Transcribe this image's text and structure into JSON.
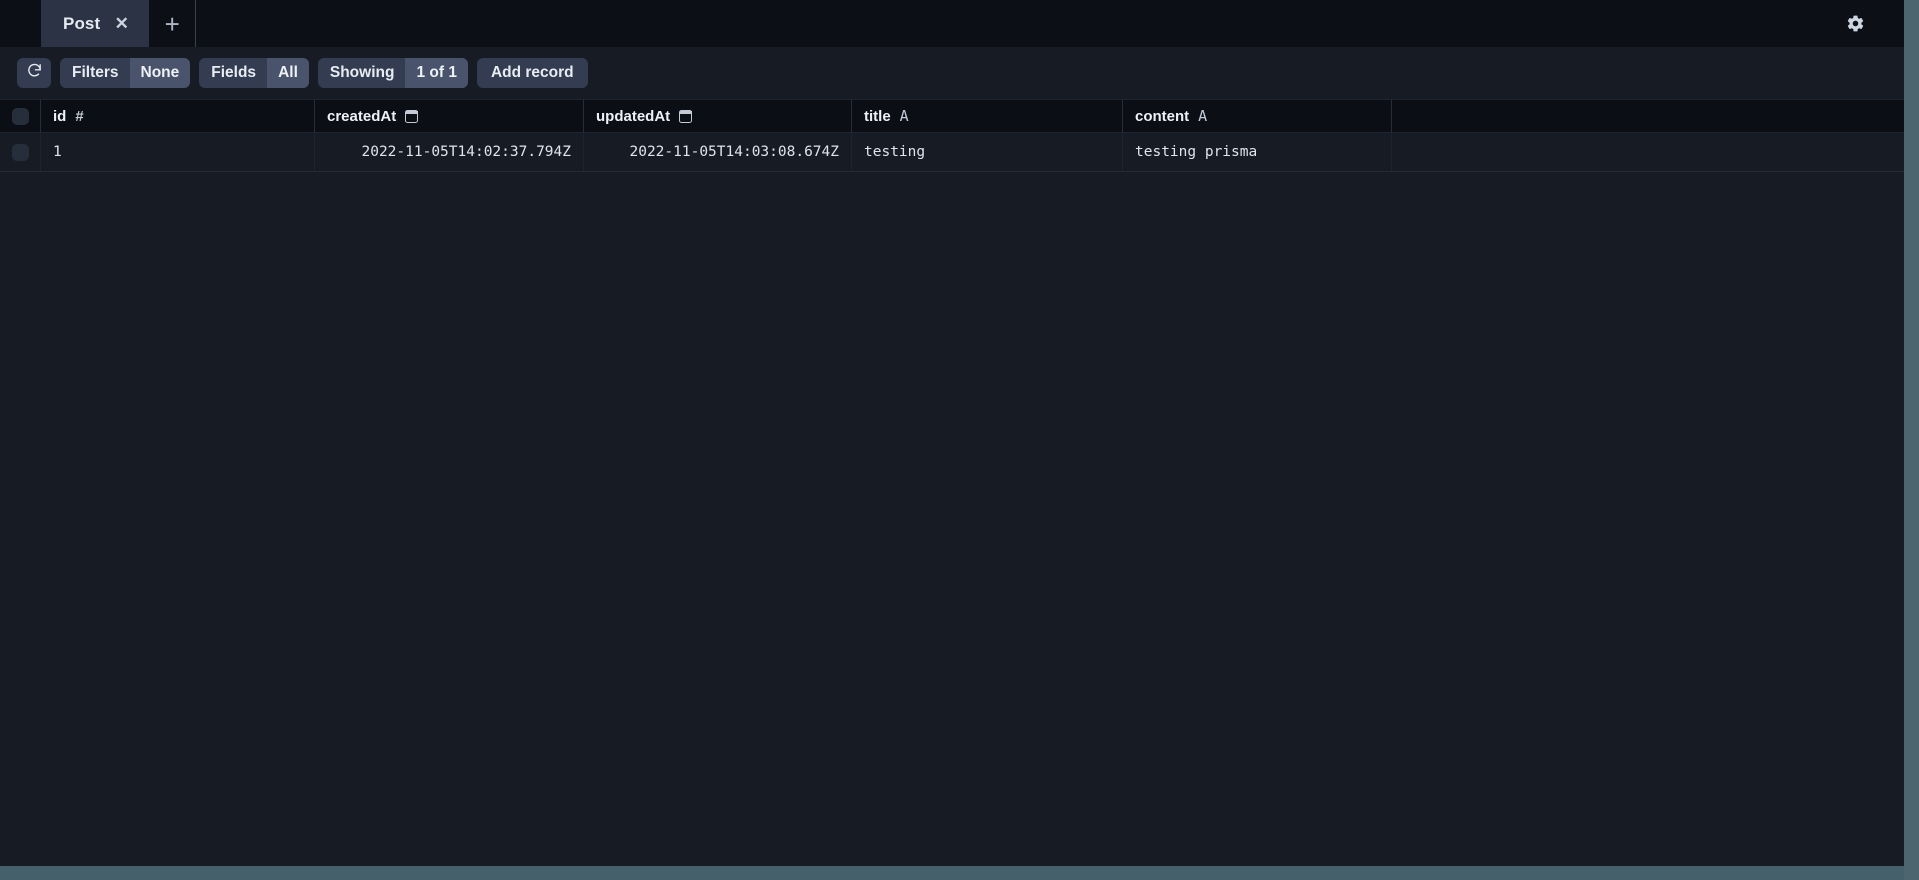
{
  "window": {
    "gear_icon": "gear-icon"
  },
  "tabs": {
    "items": [
      {
        "label": "Post",
        "close_icon": "close-icon",
        "active": true
      }
    ],
    "add_label": "+"
  },
  "toolbar": {
    "refresh_icon": "refresh-icon",
    "filters": {
      "label": "Filters",
      "value": "None"
    },
    "fields": {
      "label": "Fields",
      "value": "All"
    },
    "showing": {
      "label": "Showing",
      "value": "1 of 1"
    },
    "add_record_label": "Add record"
  },
  "table": {
    "columns": [
      {
        "name": "id",
        "type_icon": "#",
        "icon_kind": "hash",
        "align": "right"
      },
      {
        "name": "createdAt",
        "type_icon": "",
        "icon_kind": "calendar",
        "align": "right"
      },
      {
        "name": "updatedAt",
        "type_icon": "",
        "icon_kind": "calendar",
        "align": "right"
      },
      {
        "name": "title",
        "type_icon": "A",
        "icon_kind": "text",
        "align": "left"
      },
      {
        "name": "content",
        "type_icon": "A",
        "icon_kind": "text",
        "align": "left"
      }
    ],
    "rows": [
      {
        "id": "1",
        "createdAt": "2022-11-05T14:02:37.794Z",
        "updatedAt": "2022-11-05T14:03:08.674Z",
        "title": "testing",
        "content": "testing prisma"
      }
    ]
  },
  "colors": {
    "page_bg": "#161b24",
    "tabbar_bg": "#0c0f15",
    "tab_active_bg": "#2c3344",
    "header_row_bg": "#0b0e14",
    "button_bg": "#333c50",
    "button_value_bg": "#49536b",
    "scrollbar": "#4c656f"
  }
}
